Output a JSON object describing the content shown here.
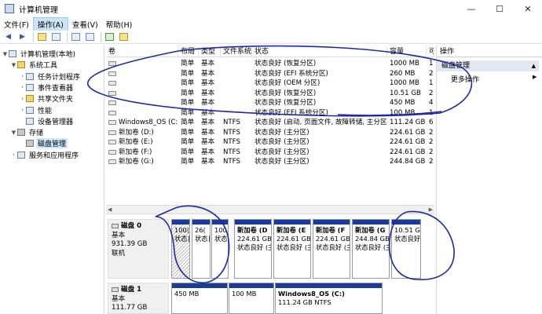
{
  "window": {
    "title": "计算机管理",
    "minimize": "—",
    "maximize": "☐",
    "close": "✕"
  },
  "menu": [
    "文件(F)",
    "操作(A)",
    "查看(V)",
    "帮助(H)"
  ],
  "tree": [
    {
      "label": "计算机管理(本地)",
      "indent": 0,
      "twisty": "▼",
      "icon": "computer-icon"
    },
    {
      "label": "系统工具",
      "indent": 1,
      "twisty": "▼",
      "icon": "tools-icon"
    },
    {
      "label": "任务计划程序",
      "indent": 2,
      "twisty": "›",
      "icon": "clock-icon"
    },
    {
      "label": "事件查看器",
      "indent": 2,
      "twisty": "›",
      "icon": "event-icon"
    },
    {
      "label": "共享文件夹",
      "indent": 2,
      "twisty": "›",
      "icon": "folder-icon"
    },
    {
      "label": "性能",
      "indent": 2,
      "twisty": "›",
      "icon": "performance-icon"
    },
    {
      "label": "设备管理器",
      "indent": 2,
      "twisty": "",
      "icon": "device-icon"
    },
    {
      "label": "存储",
      "indent": 1,
      "twisty": "▼",
      "icon": "storage-icon"
    },
    {
      "label": "磁盘管理",
      "indent": 2,
      "twisty": "",
      "icon": "disk-icon",
      "selected": true
    },
    {
      "label": "服务和应用程序",
      "indent": 1,
      "twisty": "›",
      "icon": "services-icon"
    }
  ],
  "columns": [
    "卷",
    "布局",
    "类型",
    "文件系统",
    "状态",
    "容量",
    "可"
  ],
  "volumes": [
    {
      "name": "",
      "layout": "简单",
      "type": "基本",
      "fs": "",
      "status": "状态良好 (恢复分区)",
      "capacity": "1000 MB",
      "free": "1"
    },
    {
      "name": "",
      "layout": "简单",
      "type": "基本",
      "fs": "",
      "status": "状态良好 (EFI 系统分区)",
      "capacity": "260 MB",
      "free": "2"
    },
    {
      "name": "",
      "layout": "简单",
      "type": "基本",
      "fs": "",
      "status": "状态良好 (OEM 分区)",
      "capacity": "1000 MB",
      "free": "1"
    },
    {
      "name": "",
      "layout": "简单",
      "type": "基本",
      "fs": "",
      "status": "状态良好 (恢复分区)",
      "capacity": "10.51 GB",
      "free": "2"
    },
    {
      "name": "",
      "layout": "简单",
      "type": "基本",
      "fs": "",
      "status": "状态良好 (恢复分区)",
      "capacity": "450 MB",
      "free": "4"
    },
    {
      "name": "",
      "layout": "简单",
      "type": "基本",
      "fs": "",
      "status": "状态良好 (EFI 系统分区)",
      "capacity": "100 MB",
      "free": "1"
    },
    {
      "name": "Windows8_OS (C:)",
      "layout": "简单",
      "type": "基本",
      "fs": "NTFS",
      "status": "状态良好 (启动, 页面文件, 故障转储, 主分区)",
      "capacity": "111.24 GB",
      "free": "6"
    },
    {
      "name": "新加卷 (D:)",
      "layout": "简单",
      "type": "基本",
      "fs": "NTFS",
      "status": "状态良好 (主分区)",
      "capacity": "224.61 GB",
      "free": "2"
    },
    {
      "name": "新加卷 (E:)",
      "layout": "简单",
      "type": "基本",
      "fs": "NTFS",
      "status": "状态良好 (主分区)",
      "capacity": "224.61 GB",
      "free": "2"
    },
    {
      "name": "新加卷 (F:)",
      "layout": "简单",
      "type": "基本",
      "fs": "NTFS",
      "status": "状态良好 (主分区)",
      "capacity": "224.61 GB",
      "free": "2"
    },
    {
      "name": "新加卷 (G:)",
      "layout": "简单",
      "type": "基本",
      "fs": "NTFS",
      "status": "状态良好 (主分区)",
      "capacity": "244.84 GB",
      "free": "2"
    }
  ],
  "disks": [
    {
      "name": "磁盘 0",
      "kind": "基本",
      "size": "931.39 GB",
      "state": "联机",
      "partitions": [
        {
          "name": "",
          "size": "100(",
          "status": "状态良",
          "hatched": true
        },
        {
          "name": "",
          "size": "26(",
          "status": "状态良"
        },
        {
          "name": "",
          "size": "100",
          "status": "状态良"
        },
        {
          "name": "新加卷 (D",
          "size": "224.61 GB",
          "status": "状态良好 (主"
        },
        {
          "name": "新加卷 (E",
          "size": "224.61 GB",
          "status": "状态良好 (主"
        },
        {
          "name": "新加卷 (F",
          "size": "224.61 GB",
          "status": "状态良好 (主"
        },
        {
          "name": "新加卷 (G",
          "size": "244.84 GB",
          "status": "状态良好 (主"
        },
        {
          "name": "",
          "size": "10.51 G",
          "status": "状态良好"
        }
      ]
    },
    {
      "name": "磁盘 1",
      "kind": "基本",
      "size": "111.77 GB",
      "state": "",
      "partitions": [
        {
          "name": "",
          "size": "450 MB",
          "status": ""
        },
        {
          "name": "",
          "size": "100 MB",
          "status": ""
        },
        {
          "name": "Windows8_OS  (C:)",
          "size": "111.24 GB  NTFS",
          "status": ""
        }
      ]
    }
  ],
  "actions": {
    "title": "操作",
    "section": "磁盘管理",
    "more": "更多操作"
  },
  "colors": {
    "partition_bar": "#1a3b9a",
    "ink": "#1b2aa8",
    "selection": "#cce8ff"
  }
}
